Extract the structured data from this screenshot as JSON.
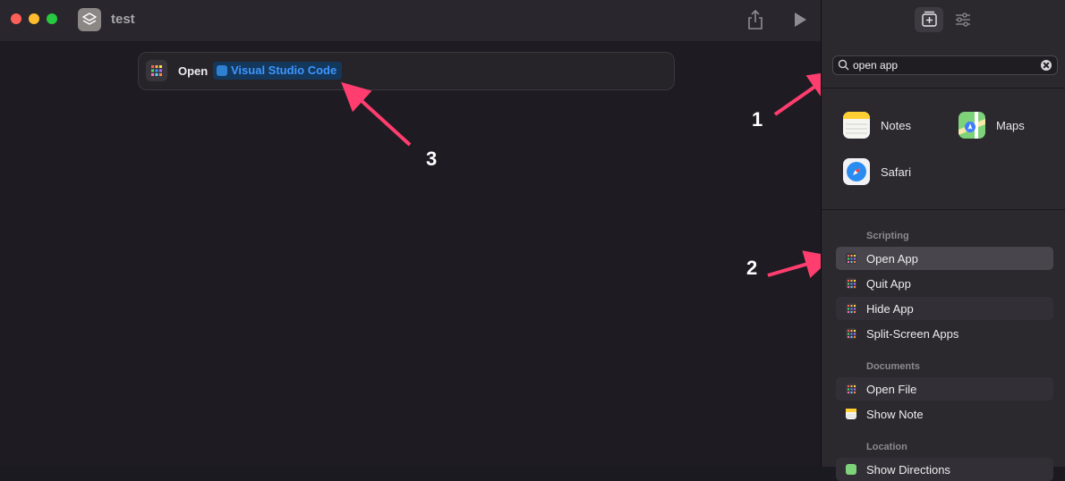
{
  "window": {
    "title": "test"
  },
  "action": {
    "verb": "Open",
    "app_token": "Visual Studio Code"
  },
  "annotations": [
    "1",
    "2",
    "3"
  ],
  "search": {
    "value": "open app"
  },
  "suggested_apps": [
    {
      "label": "Notes",
      "icon": "notes-icon"
    },
    {
      "label": "Maps",
      "icon": "maps-icon"
    },
    {
      "label": "Safari",
      "icon": "safari-icon"
    }
  ],
  "sections": {
    "scripting": "Scripting",
    "documents": "Documents",
    "location": "Location"
  },
  "scripting_items": [
    {
      "label": "Open App",
      "selected": true
    },
    {
      "label": "Quit App"
    },
    {
      "label": "Hide App"
    },
    {
      "label": "Split-Screen Apps"
    }
  ],
  "documents_items": [
    {
      "label": "Open File"
    },
    {
      "label": "Show Note"
    }
  ],
  "location_items": [
    {
      "label": "Show Directions"
    }
  ],
  "colors": {
    "accent_token_bg": "#14375c",
    "accent_token_text": "#3d97ff",
    "annotation_arrow": "#ff3d6e"
  }
}
